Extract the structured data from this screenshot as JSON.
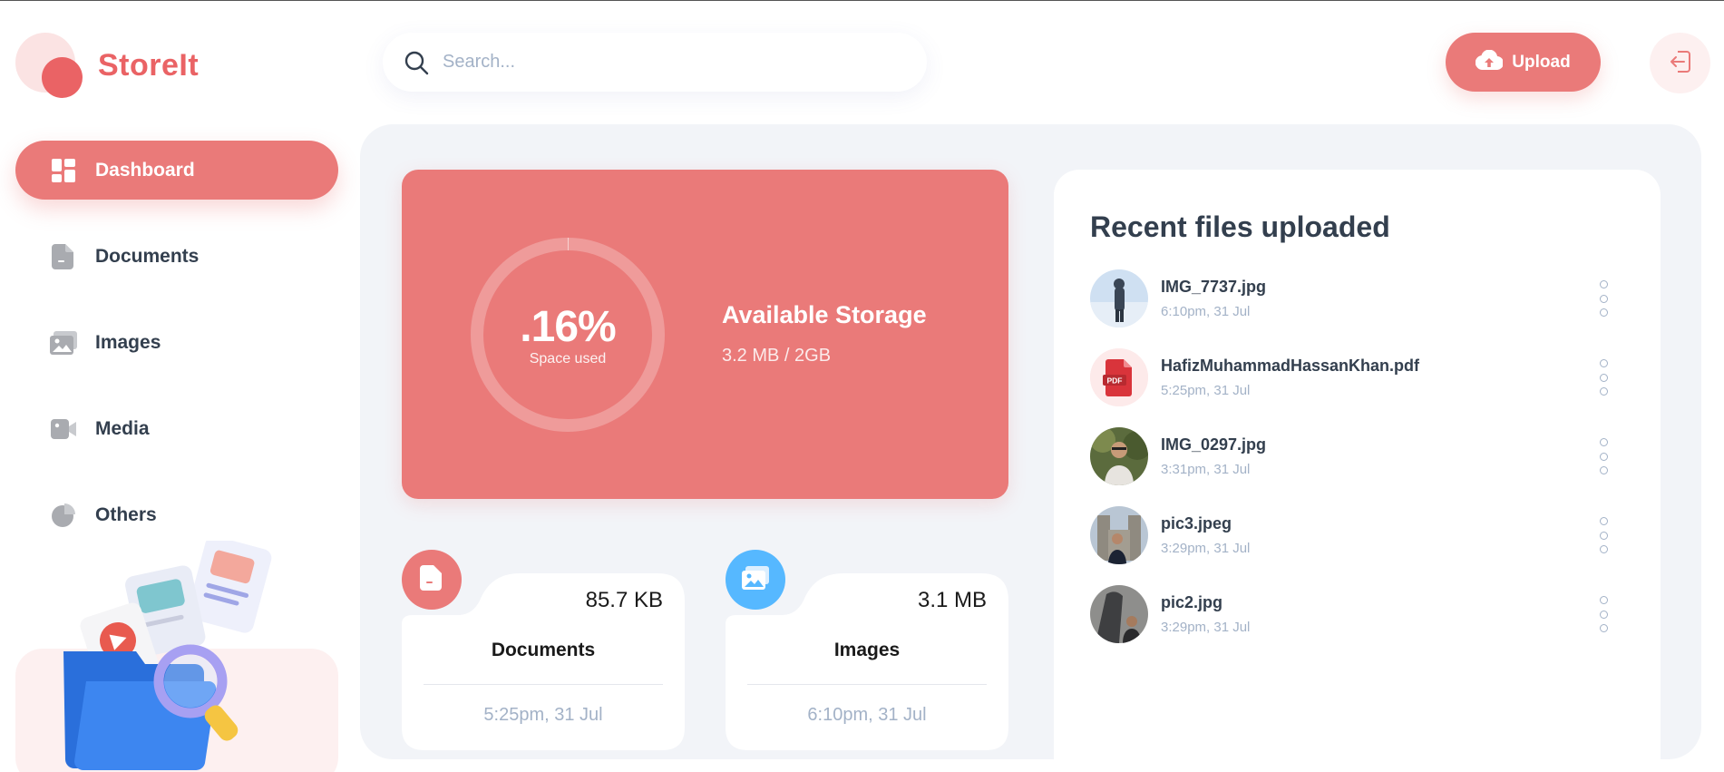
{
  "app": {
    "name": "StoreIt"
  },
  "sidebar": {
    "items": [
      {
        "label": "Dashboard",
        "icon": "dashboard-icon",
        "active": true
      },
      {
        "label": "Documents",
        "icon": "document-icon",
        "active": false
      },
      {
        "label": "Images",
        "icon": "images-icon",
        "active": false
      },
      {
        "label": "Media",
        "icon": "video-icon",
        "active": false
      },
      {
        "label": "Others",
        "icon": "pie-chart-icon",
        "active": false
      }
    ]
  },
  "header": {
    "search_placeholder": "Search...",
    "upload_label": "Upload"
  },
  "storage": {
    "percent": ".16%",
    "percent_label": "Space used",
    "title": "Available Storage",
    "amount": "3.2 MB / 2GB"
  },
  "summary": [
    {
      "category": "Documents",
      "size": "85.7 KB",
      "time": "5:25pm, 31 Jul",
      "icon": "document-icon",
      "color": "#ea7a79"
    },
    {
      "category": "Images",
      "size": "3.1 MB",
      "time": "6:10pm, 31 Jul",
      "icon": "images-icon",
      "color": "#56b8ff"
    }
  ],
  "recent": {
    "title": "Recent files uploaded",
    "files": [
      {
        "name": "IMG_7737.jpg",
        "date": "6:10pm, 31 Jul",
        "thumb": "photo-icon"
      },
      {
        "name": "HafizMuhammadHassanKhan.pdf",
        "date": "5:25pm, 31 Jul",
        "thumb": "pdf-icon"
      },
      {
        "name": "IMG_0297.jpg",
        "date": "3:31pm, 31 Jul",
        "thumb": "photo-icon"
      },
      {
        "name": "pic3.jpeg",
        "date": "3:29pm, 31 Jul",
        "thumb": "photo-icon"
      },
      {
        "name": "pic2.jpg",
        "date": "3:29pm, 31 Jul",
        "thumb": "photo-icon"
      }
    ]
  },
  "colors": {
    "brand": "#ea7a79",
    "brand_dark": "#ea6365",
    "light": "#f2f4f8",
    "muted": "#a3b2c7",
    "text": "#333f4e",
    "blue": "#56b8ff"
  }
}
